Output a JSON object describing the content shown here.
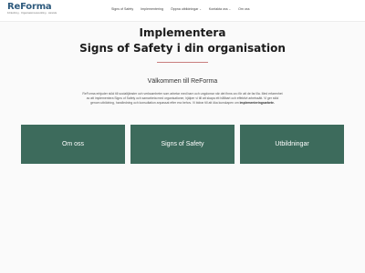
{
  "logo": {
    "name": "ReForma",
    "tagline": "Förändring · Organisationsutveckling · Lärande"
  },
  "nav": [
    {
      "label": "Signs of Safety",
      "dropdown": false
    },
    {
      "label": "Implementering",
      "dropdown": false
    },
    {
      "label": "Öppna utbildningar",
      "dropdown": true
    },
    {
      "label": "Kontakta oss",
      "dropdown": true
    },
    {
      "label": "Om oss",
      "dropdown": false
    }
  ],
  "hero": {
    "line1": "Implementera",
    "line2": "Signs of Safety i din organisation"
  },
  "welcome": "Välkommen till ReForma",
  "intro": {
    "text": "ReForma erbjuder stöd till socialtjänster och verksamheter som arbetar med barn och ungdomar när det finns oro för att de far illa. Med erfarenhet av att implementera Signs of Safety och samarbeta med organisationer, hjälper vi till att skapa ett hållbart och effektivt arbetssätt. Vi ger stöd genom utbildning, handledning och konsultation anpassat efter era behov. Vi bidrar till att öka kunskapen om",
    "bold": "implementeringsarbete."
  },
  "tiles": [
    {
      "label": "Om oss"
    },
    {
      "label": "Signs of Safety"
    },
    {
      "label": "Utbildningar"
    }
  ],
  "colors": {
    "brand": "#2e5a7d",
    "tile": "#3d6b5c",
    "accent_line": "#c97f7f"
  }
}
